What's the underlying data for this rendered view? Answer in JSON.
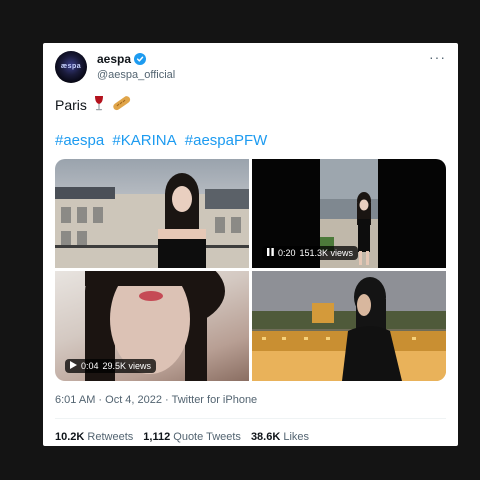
{
  "tweet": {
    "account_name": "aespa",
    "handle": "@aespa_official",
    "avatar_text": "æspa",
    "text": "Paris",
    "emojis": [
      "wine-glass",
      "baguette"
    ],
    "hashtags": [
      "#aespa",
      "#KARINA",
      "#aespaPFW"
    ],
    "media": [
      {
        "type": "photo"
      },
      {
        "type": "video",
        "duration": "0:20",
        "views": "151.3K views"
      },
      {
        "type": "video",
        "duration": "0:04",
        "views": "29.5K views"
      },
      {
        "type": "photo"
      }
    ],
    "timestamp": "6:01 AM · Oct 4, 2022 · Twitter for iPhone",
    "stats": {
      "retweets_count": "10.2K",
      "retweets_label": "Retweets",
      "quotes_count": "1,112",
      "quotes_label": "Quote Tweets",
      "likes_count": "38.6K",
      "likes_label": "Likes"
    }
  },
  "colors": {
    "accent": "#1d9bf0",
    "text": "#0f1419",
    "muted": "#536471",
    "background": "#141414"
  }
}
